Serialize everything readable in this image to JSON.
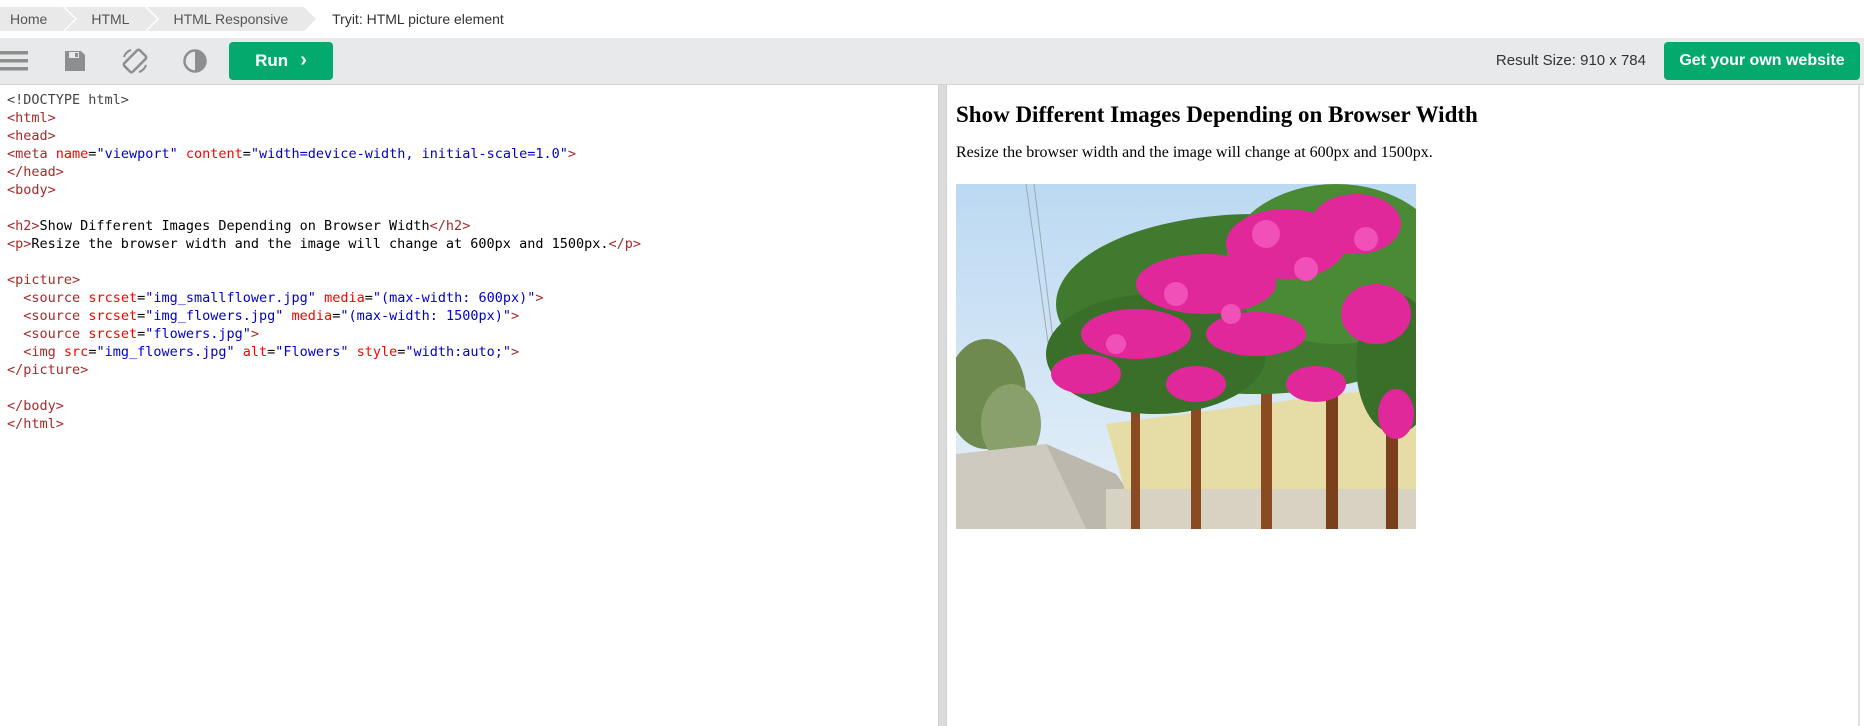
{
  "breadcrumb": {
    "items": [
      "Home",
      "HTML",
      "HTML Responsive"
    ],
    "current": "Tryit: HTML picture element"
  },
  "toolbar": {
    "icons": [
      "menu-icon",
      "save-icon",
      "rotate-icon",
      "contrast-icon"
    ],
    "run_label": "Run",
    "result_size": "Result Size: 910 x 784",
    "own_website_label": "Get your own website"
  },
  "colors": {
    "accent": "#04aa6d",
    "toolbar_bg": "#e7e9eb",
    "tag": "#a52a2a",
    "attr": "#ff0000",
    "value": "#0000cd"
  },
  "editor": {
    "lines": [
      "<!DOCTYPE html>",
      "<html>",
      "<head>",
      "<meta name=\"viewport\" content=\"width=device-width, initial-scale=1.0\">",
      "</head>",
      "<body>",
      "",
      "<h2>Show Different Images Depending on Browser Width</h2>",
      "<p>Resize the browser width and the image will change at 600px and 1500px.</p>",
      "",
      "<picture>",
      "  <source srcset=\"img_smallflower.jpg\" media=\"(max-width: 600px)\">",
      "  <source srcset=\"img_flowers.jpg\" media=\"(max-width: 1500px)\">",
      "  <source srcset=\"flowers.jpg\">",
      "  <img src=\"img_flowers.jpg\" alt=\"Flowers\" style=\"width:auto;\">",
      "</picture>",
      "",
      "</body>",
      "</html>"
    ]
  },
  "result": {
    "heading": "Show Different Images Depending on Browser Width",
    "paragraph": "Resize the browser width and the image will change at 600px and 1500px.",
    "image_alt": "Flowers"
  }
}
